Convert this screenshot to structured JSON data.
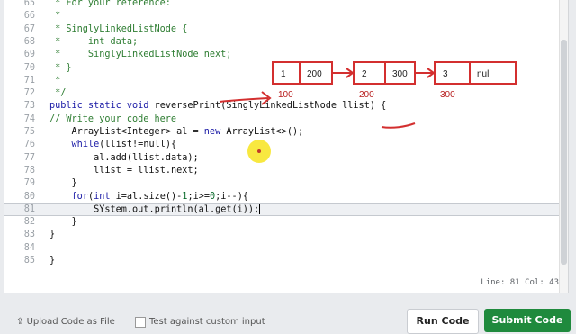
{
  "editor": {
    "lines": [
      {
        "num": "65",
        "text": " * For your reference:",
        "kind": "comment"
      },
      {
        "num": "66",
        "text": " *",
        "kind": "comment"
      },
      {
        "num": "67",
        "text": " * SinglyLinkedListNode {",
        "kind": "comment"
      },
      {
        "num": "68",
        "text": " *     int data;",
        "kind": "comment"
      },
      {
        "num": "69",
        "text": " *     SinglyLinkedListNode next;",
        "kind": "comment"
      },
      {
        "num": "70",
        "text": " * }",
        "kind": "comment"
      },
      {
        "num": "71",
        "text": " *",
        "kind": "comment"
      },
      {
        "num": "72",
        "text": " */",
        "kind": "comment"
      },
      {
        "num": "73",
        "text": "public static void reversePrint(SinglyLinkedListNode llist) {",
        "kind": "decl"
      },
      {
        "num": "74",
        "text": "// Write your code here",
        "kind": "comment"
      },
      {
        "num": "75",
        "text": "    ArrayList<Integer> al = new ArrayList<>();",
        "kind": "code"
      },
      {
        "num": "76",
        "text": "    while(llist!=null){",
        "kind": "code"
      },
      {
        "num": "77",
        "text": "        al.add(llist.data);",
        "kind": "code"
      },
      {
        "num": "78",
        "text": "        llist = llist.next;",
        "kind": "code"
      },
      {
        "num": "79",
        "text": "    }",
        "kind": "code"
      },
      {
        "num": "80",
        "text": "    for(int i=al.size()-1;i>=0;i--){",
        "kind": "code"
      },
      {
        "num": "81",
        "text": "        SYstem.out.println(al.get(i));",
        "kind": "code",
        "active": true
      },
      {
        "num": "82",
        "text": "    }",
        "kind": "code"
      },
      {
        "num": "83",
        "text": "}",
        "kind": "code"
      },
      {
        "num": "84",
        "text": "",
        "kind": "code"
      },
      {
        "num": "85",
        "text": "}",
        "kind": "code"
      }
    ],
    "status": "Line: 81 Col: 43"
  },
  "annotation": {
    "nodes": [
      {
        "data": "1",
        "next": "200",
        "address": "100"
      },
      {
        "data": "2",
        "next": "300",
        "address": "200"
      },
      {
        "data": "3",
        "next": "null",
        "address": "300"
      }
    ],
    "ink_color": "#d32f2f",
    "highlight_color": "#f5e000"
  },
  "footer": {
    "upload_label": "Upload Code as File",
    "test_label": "Test against custom input",
    "run_label": "Run Code",
    "submit_label": "Submit Code"
  },
  "colors": {
    "submit": "#1f8a3d",
    "comment": "#2e7d32",
    "keyword": "#1a1aa6"
  }
}
